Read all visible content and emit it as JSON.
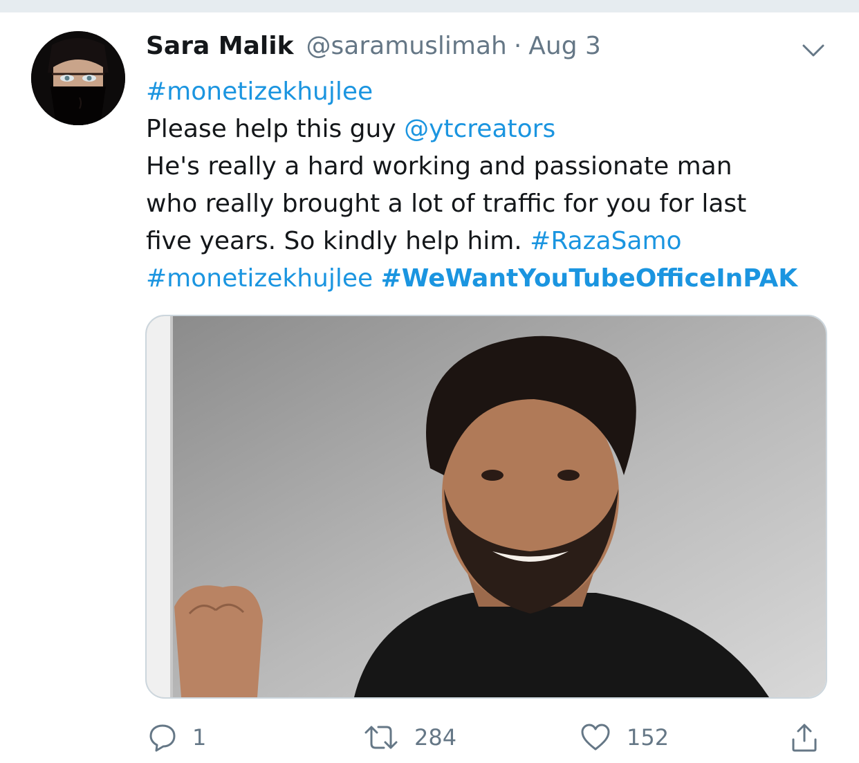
{
  "tweet": {
    "author": {
      "name": "Sara Malik",
      "handle": "@saramuslimah",
      "separator": "·",
      "date": "Aug 3"
    },
    "text": {
      "line1": {
        "tag": "#monetizekhujlee"
      },
      "line2": {
        "prefix": "Please help this guy ",
        "mention": "@ytcreators"
      },
      "line3": "He's really a hard working and passionate man",
      "line4": "who really brought a lot of traffic for you for last",
      "line5": {
        "prefix": "five years. So kindly help him. ",
        "tag": "#RazaSamo"
      },
      "line6": {
        "tag": "#monetizekhujlee",
        "space": " ",
        "tag_bold": "#WeWantYouTubeOfficeInPAK"
      }
    },
    "actions": {
      "reply_count": "1",
      "retweet_count": "284",
      "like_count": "152"
    }
  },
  "icons": {
    "menu": "chevron-down-icon",
    "reply": "reply-icon",
    "retweet": "retweet-icon",
    "like": "heart-icon",
    "share": "share-icon"
  },
  "colors": {
    "link": "#1b95e0",
    "secondary_text": "#657786",
    "primary_text": "#14171a",
    "border": "#ccd6dd"
  }
}
